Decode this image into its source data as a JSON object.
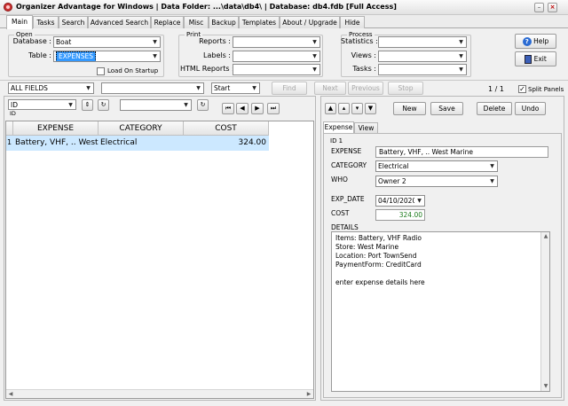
{
  "window": {
    "title": "Organizer Advantage for Windows | Data Folder: ...\\data\\db4\\ | Database: db4.fdb [Full Access]",
    "minimize_glyph": "–",
    "close_glyph": "×"
  },
  "tabs": [
    "Main",
    "Tasks",
    "Search",
    "Advanced Search",
    "Replace",
    "Misc",
    "Backup",
    "Templates",
    "About / Upgrade",
    "Hide"
  ],
  "open_group": {
    "title": "Open",
    "database_label": "Database :",
    "database_value": "Boat",
    "table_label": "Table :",
    "table_value": "EXPENSES",
    "load_on_startup_label": "Load On Startup"
  },
  "print_group": {
    "title": "Print",
    "reports_label": "Reports :",
    "labels_label": "Labels :",
    "html_reports_label": "HTML Reports :"
  },
  "process_group": {
    "title": "Process",
    "statistics_label": "Statistics :",
    "views_label": "Views :",
    "tasks_label": "Tasks :"
  },
  "help_button": "Help",
  "exit_button": "Exit",
  "search_bar": {
    "field_value": "ALL FIELDS",
    "mode_value": "Start",
    "find": "Find",
    "next": "Next",
    "previous": "Previous",
    "stop": "Stop",
    "record_position": "1 / 1",
    "split_panels": "Split Panels"
  },
  "sort": {
    "field_value": "ID",
    "field_caption": "ID"
  },
  "grid": {
    "columns": [
      "EXPENSE",
      "CATEGORY",
      "COST"
    ],
    "rows": [
      {
        "indicator": "1",
        "expense": "Battery, VHF, .. West",
        "category": "Electrical",
        "cost": "324.00"
      }
    ]
  },
  "record_toolbar": {
    "new": "New",
    "save": "Save",
    "delete": "Delete",
    "undo": "Undo"
  },
  "detail_tabs": [
    "Expense",
    "View"
  ],
  "record": {
    "id_label": "ID 1",
    "expense_label": "EXPENSE",
    "expense_value": "Battery, VHF, .. West Marine",
    "category_label": "CATEGORY",
    "category_value": "Electrical",
    "who_label": "WHO",
    "who_value": "Owner 2",
    "exp_date_label": "EXP_DATE",
    "exp_date_value": "04/10/2020",
    "cost_label": "COST",
    "cost_value": "324.00",
    "details_label": "DETAILS",
    "details_lines": [
      "Items: Battery, VHF Radio",
      "Store: West Marine",
      "Location: Port TownSend",
      "PaymentForm: CreditCard",
      "",
      "enter expense details here"
    ]
  },
  "colors": {
    "selection_row": "#cce8ff",
    "accent_blue": "#3399ff",
    "cost_green": "#1a7a1a"
  }
}
